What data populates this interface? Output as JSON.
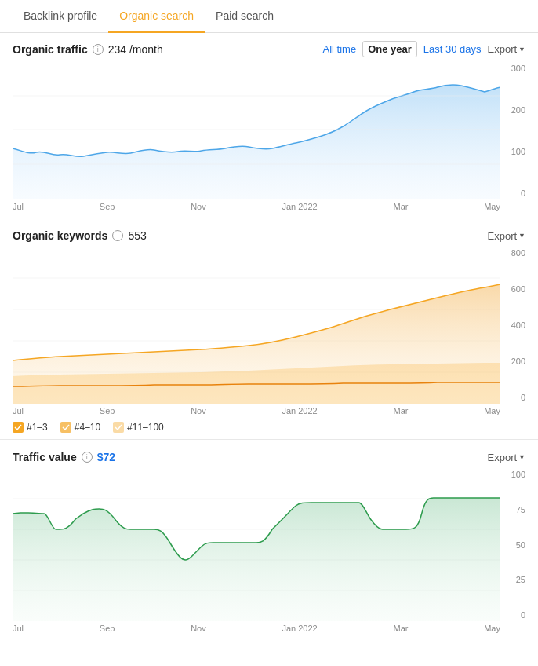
{
  "tabs": [
    {
      "id": "backlink",
      "label": "Backlink profile",
      "active": false
    },
    {
      "id": "organic",
      "label": "Organic search",
      "active": true
    },
    {
      "id": "paid",
      "label": "Paid search",
      "active": false
    }
  ],
  "sections": {
    "organic_traffic": {
      "title": "Organic traffic",
      "value": "234 /month",
      "time_filters": [
        {
          "label": "All time",
          "active": false,
          "type": "link"
        },
        {
          "label": "One year",
          "active": true
        },
        {
          "label": "Last 30 days",
          "active": false,
          "type": "link"
        }
      ],
      "export_label": "Export",
      "x_labels": [
        "Jul",
        "Sep",
        "Nov",
        "Jan 2022",
        "Mar",
        "May"
      ],
      "y_labels": [
        "300",
        "200",
        "100",
        "0"
      ]
    },
    "organic_keywords": {
      "title": "Organic keywords",
      "value": "553",
      "export_label": "Export",
      "x_labels": [
        "Jul",
        "Sep",
        "Nov",
        "Jan 2022",
        "Mar",
        "May"
      ],
      "y_labels": [
        "800",
        "600",
        "400",
        "200",
        "0"
      ],
      "legend": [
        {
          "label": "#1–3",
          "color": "#f5a623",
          "checked": true
        },
        {
          "label": "#4–10",
          "color": "#f5a623",
          "checked": true
        },
        {
          "label": "#11–100",
          "color": "#f5a623",
          "checked": true
        }
      ]
    },
    "traffic_value": {
      "title": "Traffic value",
      "value": "$72",
      "export_label": "Export",
      "x_labels": [
        "Jul",
        "Sep",
        "Nov",
        "Jan 2022",
        "Mar",
        "May"
      ],
      "y_labels": [
        "100",
        "75",
        "50",
        "25",
        "0"
      ]
    }
  },
  "colors": {
    "tab_active": "#f5a623",
    "blue_line": "#4da6e8",
    "blue_fill": "#dbeeff",
    "orange_line": "#e8820c",
    "orange_fill": "#ffd9a8",
    "green_line": "#2e9c4e",
    "green_fill": "#c8edd5",
    "accent_blue": "#1a73e8"
  }
}
